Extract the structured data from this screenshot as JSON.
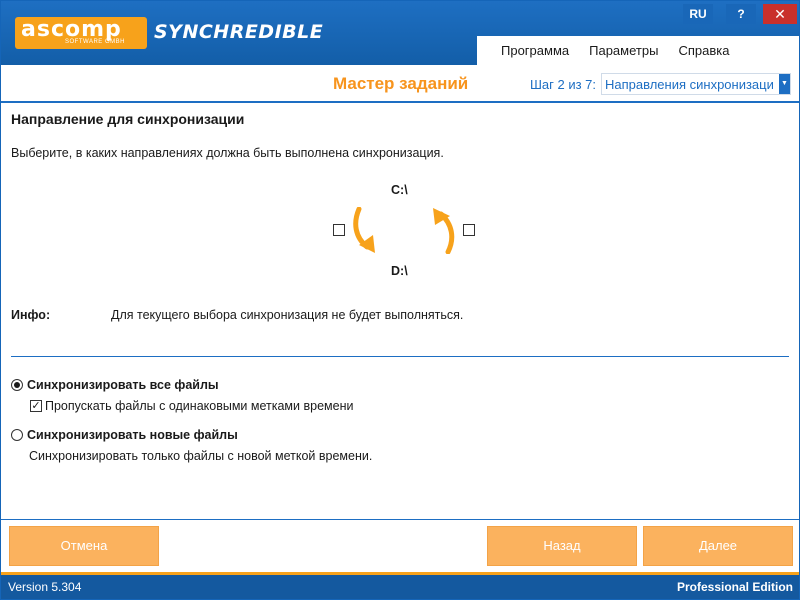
{
  "window": {
    "app_title": "SYNCHREDIBLE",
    "logo_text": "ascomp",
    "logo_subtitle": "SOFTWARE GMBH",
    "lang_button": "RU",
    "help_button": "?",
    "close_button": "✕"
  },
  "menu": [
    "Программа",
    "Параметры",
    "Справка"
  ],
  "wizard": {
    "title": "Мастер заданий",
    "step_label": "Шаг 2 из 7:",
    "step_value": "Направления синхронизаци"
  },
  "content": {
    "section_title": "Направление для синхронизации",
    "section_desc": "Выберите, в каких направлениях должна быть выполнена синхронизация.",
    "source_drive": "C:\\",
    "target_drive": "D:\\",
    "left_direction_checked": false,
    "right_direction_checked": false,
    "info_label": "Инфо:",
    "info_text": "Для текущего выбора синхронизация не будет выполняться."
  },
  "options": {
    "sync_all": {
      "label": "Синхронизировать все файлы",
      "selected": true,
      "skip_same_time": {
        "label": "Пропускать файлы с одинаковыми метками времени",
        "checked": true
      }
    },
    "sync_new": {
      "label": "Синхронизировать новые файлы",
      "selected": false,
      "description": "Синхронизировать только файлы с новой меткой времени."
    }
  },
  "buttons": {
    "cancel": "Отмена",
    "back": "Назад",
    "next": "Далее"
  },
  "status": {
    "version": "Version 5.304",
    "edition": "Professional Edition"
  },
  "colors": {
    "brand_blue": "#1d6ec3",
    "accent_orange": "#f7941d",
    "button_orange": "#fbb25e"
  }
}
